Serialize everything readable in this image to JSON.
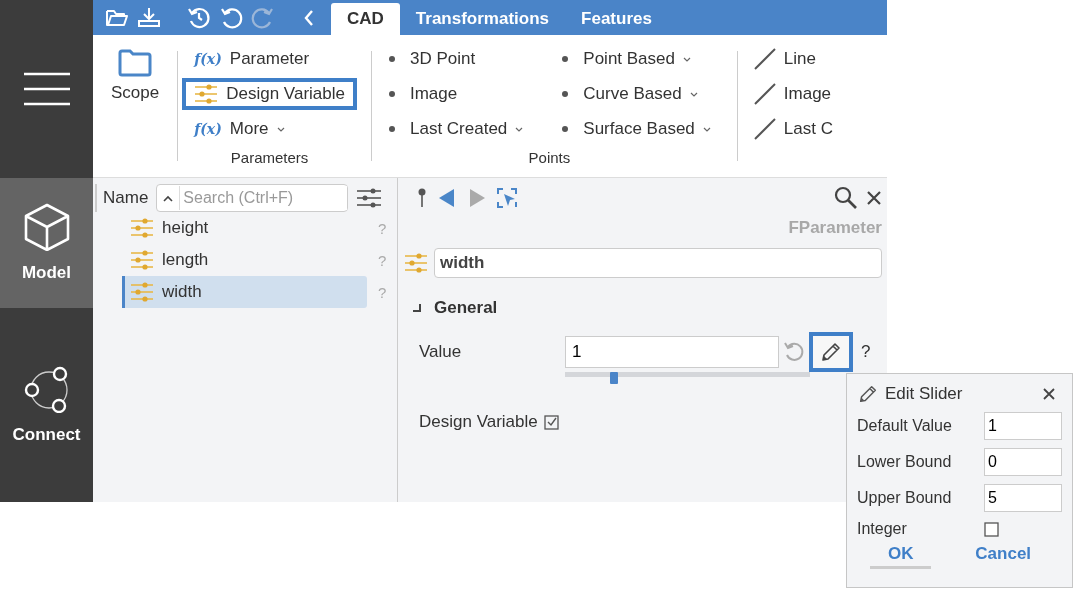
{
  "sidebar": {
    "items": [
      {
        "kind": "menu",
        "selected": false
      },
      {
        "kind": "cube",
        "label": "Model",
        "selected": true
      },
      {
        "kind": "network",
        "label": "Connect",
        "selected": false
      }
    ]
  },
  "toolbar": {
    "tools": [
      {
        "kind": "open",
        "disabled": false
      },
      {
        "kind": "download",
        "disabled": false
      },
      {
        "kind": "history",
        "disabled": false
      },
      {
        "kind": "undo",
        "disabled": false
      },
      {
        "kind": "redo",
        "disabled": true
      },
      {
        "kind": "back",
        "disabled": false
      }
    ]
  },
  "tabs": [
    {
      "label": "CAD",
      "selected": true
    },
    {
      "label": "Transformations",
      "selected": false
    },
    {
      "label": "Features",
      "selected": false
    }
  ],
  "ribbon": {
    "scope": {
      "label": "Scope"
    },
    "groups": [
      {
        "kind": "list",
        "label": "Parameters",
        "items": [
          {
            "kind": "fx",
            "icon": "f(x)",
            "label": "Parameter",
            "dropdown": false,
            "highlighted": false
          },
          {
            "kind": "slider",
            "label": "Design Variable",
            "dropdown": false,
            "highlighted": true
          },
          {
            "kind": "fx",
            "icon": "f(x)",
            "label": "More",
            "dropdown": true,
            "highlighted": false
          }
        ]
      },
      {
        "kind": "grid",
        "label": "Points",
        "items": [
          {
            "kind": "bullet",
            "label": "3D Point",
            "dropdown": false,
            "highlighted": false
          },
          {
            "kind": "bullet",
            "label": "Image",
            "dropdown": false,
            "highlighted": false
          },
          {
            "kind": "bullet",
            "label": "Last Created",
            "dropdown": true,
            "highlighted": false
          },
          {
            "kind": "bullet",
            "label": "Point Based",
            "dropdown": true,
            "highlighted": false
          },
          {
            "kind": "bullet",
            "label": "Curve Based",
            "dropdown": true,
            "highlighted": false
          },
          {
            "kind": "bullet",
            "label": "Surface Based",
            "dropdown": true,
            "highlighted": false
          }
        ]
      },
      {
        "kind": "list",
        "items": [
          {
            "kind": "line",
            "label": "Line",
            "dropdown": false,
            "highlighted": false
          },
          {
            "kind": "line",
            "label": "Image",
            "dropdown": false,
            "highlighted": false
          },
          {
            "kind": "line",
            "label": "Last C",
            "dropdown": false,
            "highlighted": false
          }
        ]
      }
    ]
  },
  "tree": {
    "column": "Name",
    "search": {
      "placeholder": "Search (Ctrl+F)"
    },
    "items": [
      {
        "label": "height",
        "help": "?",
        "selected": false
      },
      {
        "label": "length",
        "help": "?",
        "selected": false
      },
      {
        "label": "width",
        "help": "?",
        "selected": true
      }
    ]
  },
  "properties": {
    "tools": [
      {
        "kind": "pin",
        "disabled": false
      },
      {
        "kind": "prev",
        "disabled": false
      },
      {
        "kind": "next",
        "disabled": true
      },
      {
        "kind": "select",
        "disabled": false
      }
    ],
    "type": "FParameter",
    "name": "width",
    "section": {
      "label": "General",
      "expanded": true
    },
    "value": {
      "label": "Value",
      "value": "1",
      "level": 0.2,
      "help": "?",
      "edit_highlighted": true
    },
    "design_variable": {
      "label": "Design Variable",
      "checked": true
    }
  },
  "popup": {
    "title": "Edit Slider",
    "fields": [
      {
        "label": "Default Value",
        "value": "1"
      },
      {
        "label": "Lower Bound",
        "value": "0"
      },
      {
        "label": "Upper Bound",
        "value": "5"
      }
    ],
    "integer": {
      "label": "Integer",
      "checked": false
    },
    "buttons": [
      {
        "label": "OK",
        "focused": true
      },
      {
        "label": "Cancel",
        "focused": false
      }
    ]
  }
}
